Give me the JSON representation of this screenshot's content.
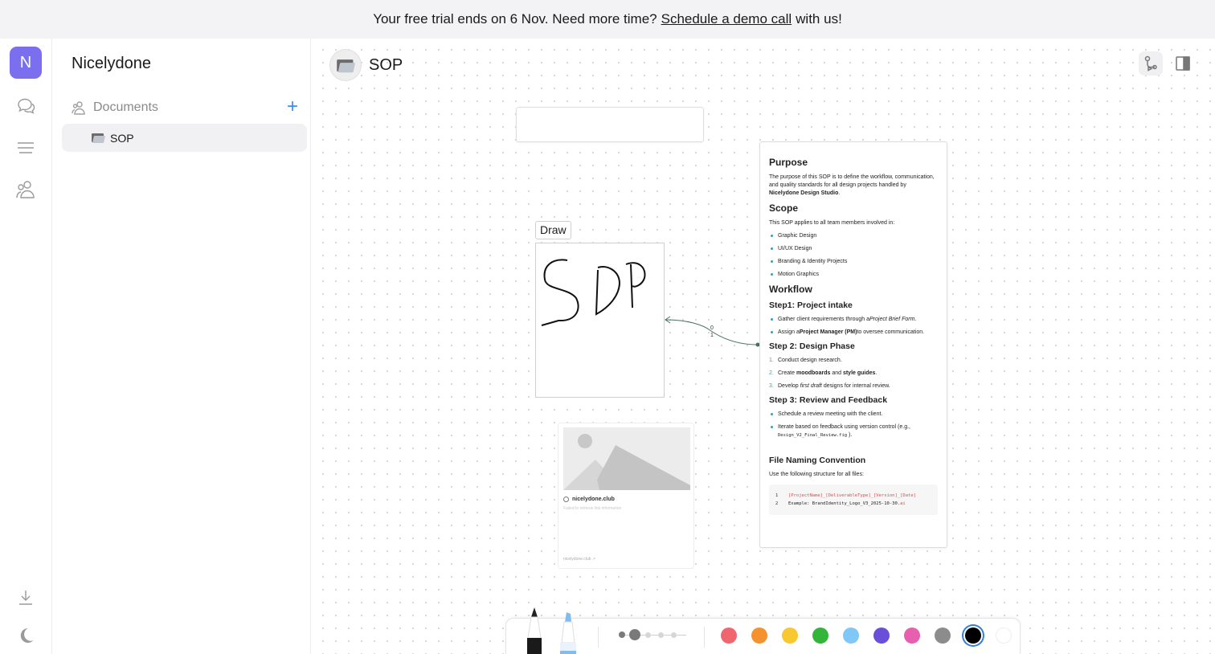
{
  "banner": {
    "text_before": "Your free trial ends on 6 Nov. Need more time?",
    "link_text": "Schedule a demo call",
    "text_after": "with us!"
  },
  "rail": {
    "avatar_initial": "N",
    "icons": [
      "chat-icon",
      "menu-icon",
      "users-icon",
      "download-icon",
      "moon-icon"
    ]
  },
  "sidebar": {
    "workspace_name": "Nicelydone",
    "section_label": "Documents",
    "add_icon": "+",
    "items": [
      {
        "label": "SOP"
      }
    ]
  },
  "page": {
    "title": "SOP"
  },
  "canvas": {
    "draw_label": "Draw",
    "drawing_text": "SOP",
    "connector_labels": [
      "0",
      "1"
    ],
    "link_card": {
      "site": "nicelydone.club",
      "error": "Failed to retrieve link information",
      "footer": "nicelydone.club ↗"
    }
  },
  "doc": {
    "purpose_heading": "Purpose",
    "purpose_text_1": "The purpose of this SOP is to define the workflow, communication, and quality standards for all design projects handled by",
    "purpose_bold": "Nicelydone Design Studio",
    "purpose_end": ".",
    "scope_heading": "Scope",
    "scope_text": "This SOP applies to all team members involved in:",
    "scope_items": [
      "Graphic Design",
      "UI/UX Design",
      "Branding & Identity Projects",
      "Motion Graphics"
    ],
    "workflow_heading": "Workflow",
    "step1_heading": "Step1: Project intake",
    "step1_item1_a": "Gather client requirements through a",
    "step1_item1_b": "Project Brief Form",
    "step1_item1_c": ".",
    "step1_item2_a": "Assign a",
    "step1_item2_b": "Project Manager (PM)",
    "step1_item2_c": "to oversee communication.",
    "step2_heading": "Step 2: Design Phase",
    "step2_item1": "Conduct design research.",
    "step2_item2_a": "Create",
    "step2_item2_b": "moodboards",
    "step2_item2_c": "and",
    "step2_item2_d": "style guides",
    "step2_item2_e": ".",
    "step2_item3_a": "Develop",
    "step2_item3_b": "first draft",
    "step2_item3_c": "designs for internal review.",
    "step3_heading": "Step 3: Review and Feedback",
    "step3_item1": "Schedule a review meeting with the client.",
    "step3_item2_a": "Iterate based on feedback using version control (e.g.,",
    "step3_item2_code": "Design_V2_Final_Review.fig",
    "step3_item2_c": ").",
    "naming_heading": "File Naming Convention",
    "naming_text": "Use the following structure for all files:",
    "code_line1": "[ProjectName]_[DeliverableType]_[Version]_[Date]",
    "code_line2_a": "Example: BrandIdentity_Logo_V3_2025-10-30.",
    "code_line2_b": "ai",
    "nums": [
      "1.",
      "2.",
      "3."
    ],
    "code_nums": [
      "1",
      "2"
    ]
  },
  "toolbar": {
    "tools": [
      "pencil-icon",
      "marker-icon"
    ],
    "sizes": 5,
    "selected_size": 1,
    "colors": [
      "#f0666e",
      "#f5922e",
      "#f8c833",
      "#33b53a",
      "#7fc7f7",
      "#6a4fdb",
      "#e95faf",
      "#8c8c8c",
      "#000000",
      "#ffffff"
    ],
    "selected_color": "#000000"
  }
}
